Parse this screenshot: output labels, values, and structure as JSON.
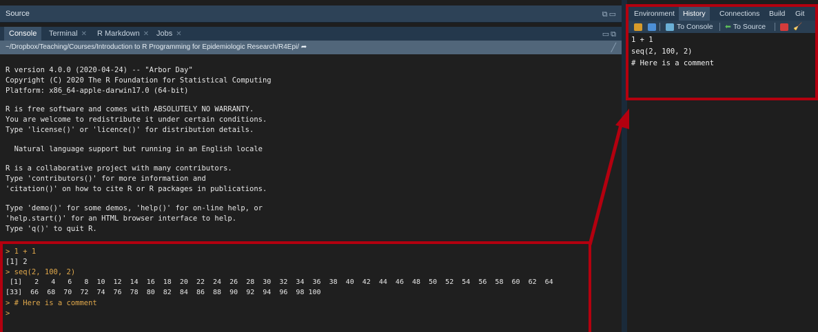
{
  "source_pane": {
    "title": "Source"
  },
  "console_tabs": [
    {
      "label": "Console",
      "closable": false
    },
    {
      "label": "Terminal",
      "closable": true
    },
    {
      "label": "R Markdown",
      "closable": true
    },
    {
      "label": "Jobs",
      "closable": true
    }
  ],
  "working_dir": "~/Dropbox/Teaching/Courses/Introduction to R Programming for Epidemiologic Research/R4Epi/",
  "console_lines": [
    "R version 4.0.0 (2020-04-24) -- \"Arbor Day\"",
    "Copyright (C) 2020 The R Foundation for Statistical Computing",
    "Platform: x86_64-apple-darwin17.0 (64-bit)",
    "R is free software and comes with ABSOLUTELY NO WARRANTY.",
    "You are welcome to redistribute it under certain conditions.",
    "Type 'license()' or 'licence()' for distribution details.",
    "  Natural language support but running in an English locale",
    "R is a collaborative project with many contributors.",
    "Type 'contributors()' for more information and",
    "'citation()' on how to cite R or R packages in publications.",
    "Type 'demo()' for some demos, 'help()' for on-line help, or",
    "'help.start()' for an HTML browser interface to help.",
    "Type 'q()' to quit R."
  ],
  "session_lines": [
    "> 1 + 1",
    "[1] 2",
    "> seq(2, 100, 2)",
    " [1]   2   4   6   8  10  12  14  16  18  20  22  24  26  28  30  32  34  36  38  40  42  44  46  48  50  52  54  56  58  60  62  64",
    "[33]  66  68  70  72  74  76  78  80  82  84  86  88  90  92  94  96  98 100",
    "> # Here is a comment",
    ">"
  ],
  "right_tabs": [
    "Environment",
    "History",
    "Connections",
    "Build",
    "Git"
  ],
  "history_toolbar": {
    "to_console": "To Console",
    "to_source": "To Source"
  },
  "history_entries": [
    "1 + 1",
    "seq(2, 100, 2)",
    "# Here is a comment"
  ],
  "colors": {
    "annotation": "#b3000f",
    "prompt": "#e0a84b"
  }
}
